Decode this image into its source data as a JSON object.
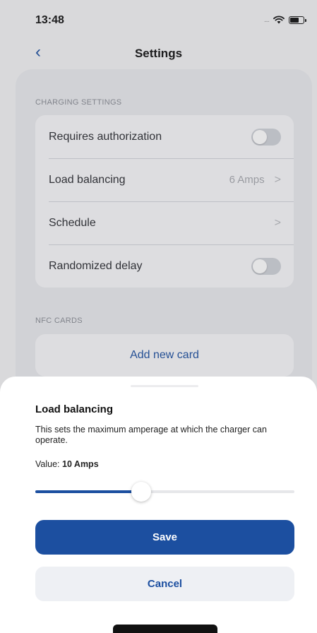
{
  "status_bar": {
    "time": "13:48"
  },
  "nav": {
    "title": "Settings",
    "back_icon": "‹"
  },
  "sections": {
    "charging": {
      "header": "CHARGING SETTINGS",
      "items": [
        {
          "label": "Requires authorization",
          "type": "toggle",
          "on": false
        },
        {
          "label": "Load balancing",
          "value": "6 Amps",
          "type": "link"
        },
        {
          "label": "Schedule",
          "type": "link"
        },
        {
          "label": "Randomized delay",
          "type": "toggle",
          "on": false
        }
      ]
    },
    "nfc": {
      "header": "NFC CARDS",
      "add_label": "Add new card"
    }
  },
  "sheet": {
    "title": "Load balancing",
    "description": "This sets the maximum amperage at which the charger can operate.",
    "value_prefix": "Value: ",
    "value": "10 Amps",
    "slider_fraction": 0.41,
    "save_label": "Save",
    "cancel_label": "Cancel"
  },
  "colors": {
    "accent": "#1c4fa0",
    "toggle_off": "#cfd2d8"
  }
}
